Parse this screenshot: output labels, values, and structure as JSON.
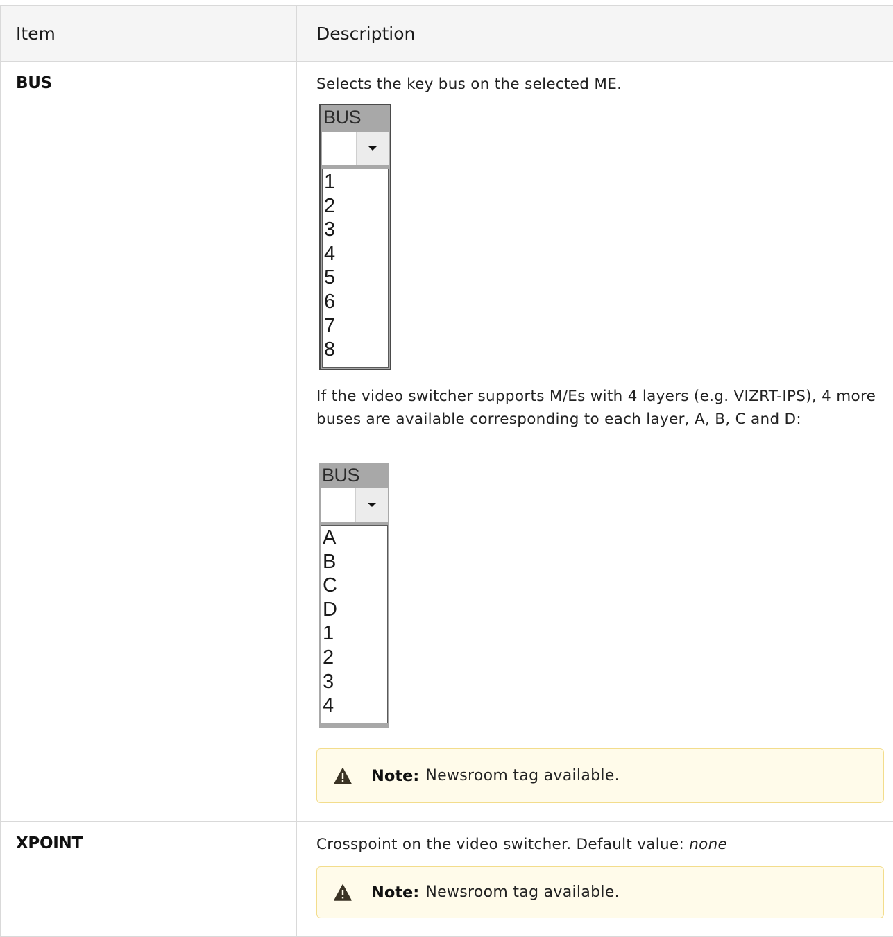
{
  "table": {
    "headers": {
      "item": "Item",
      "description": "Description"
    },
    "rows": [
      {
        "item": "BUS",
        "description": "Selects the key bus on the selected ME.",
        "widget1": {
          "title": "BUS",
          "options": [
            "1",
            "2",
            "3",
            "4",
            "5",
            "6",
            "7",
            "8"
          ]
        },
        "paragraph2": "If the video switcher supports M/Es with 4 layers (e.g. VIZRT-IPS), 4 more buses are available corresponding to each layer, A, B, C and D:",
        "widget2": {
          "title": "BUS",
          "options": [
            "A",
            "B",
            "C",
            "D",
            "1",
            "2",
            "3",
            "4"
          ]
        },
        "note": {
          "label": "Note:",
          "text": "Newsroom tag available."
        }
      },
      {
        "item": "XPOINT",
        "description_prefix": "Crosspoint on the video switcher. Default value: ",
        "description_emphasis": "none",
        "note": {
          "label": "Note:",
          "text": "Newsroom tag available."
        }
      }
    ]
  },
  "colors": {
    "note_bg": "#fffbea",
    "note_border": "#f3dd8c",
    "header_bg": "#f5f5f5"
  },
  "icons": {
    "note": "warning-triangle-icon"
  }
}
